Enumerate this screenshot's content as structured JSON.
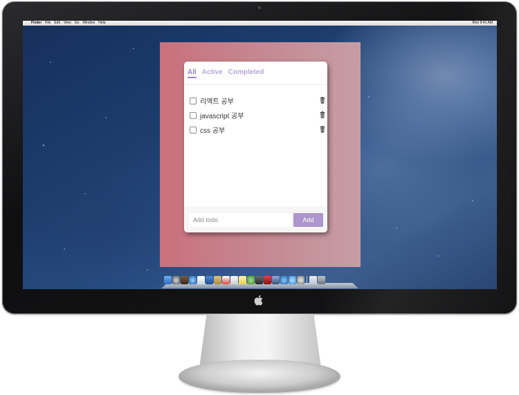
{
  "menubar": {
    "apple": "",
    "items": [
      "Finder",
      "File",
      "Edit",
      "View",
      "Go",
      "Window",
      "Help"
    ],
    "clock": "Mon 9:41 AM"
  },
  "todo": {
    "tabs": [
      {
        "label": "All",
        "active": true
      },
      {
        "label": "Active",
        "active": false
      },
      {
        "label": "Completed",
        "active": false
      }
    ],
    "items": [
      {
        "text": "리액트 공부",
        "checked": false
      },
      {
        "text": "javascript 공부",
        "checked": false
      },
      {
        "text": "css 공부",
        "checked": false
      }
    ],
    "input_placeholder": "Add todo",
    "add_label": "Add"
  },
  "colors": {
    "accent": "#9a84c6",
    "button": "#ad96cc",
    "app_background": "#c9707c"
  },
  "icons": {
    "trash": "trash-icon",
    "apple_logo": "apple-logo-icon",
    "camera": "camera-icon"
  }
}
